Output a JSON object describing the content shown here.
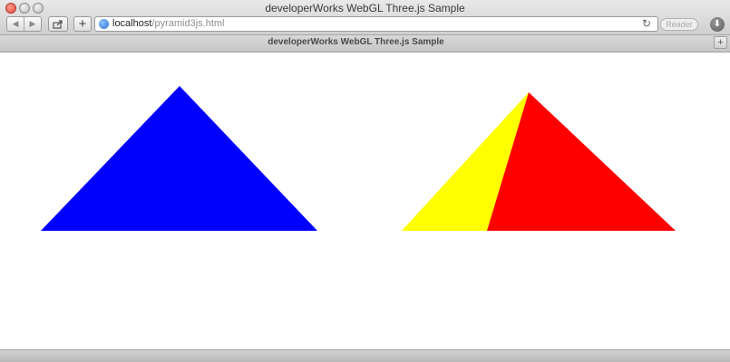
{
  "window": {
    "title": "developerWorks WebGL Three.js Sample"
  },
  "toolbar": {
    "back_glyph": "◀",
    "forward_glyph": "▶",
    "share_icon": "share-icon",
    "add_bookmark_glyph": "+",
    "address": {
      "host": "localhost",
      "path": "/pyramid3js.html"
    },
    "reload_glyph": "↻",
    "reader_label": "Reader",
    "downloads_glyph": "⬇"
  },
  "tabbar": {
    "active_tab_title": "developerWorks WebGL Three.js Sample",
    "new_tab_glyph": "+"
  },
  "scene": {
    "background": "#ffffff",
    "shapes": [
      {
        "name": "blue-triangle",
        "color": "#0000ff"
      },
      {
        "name": "yellow-pyramid-face",
        "color": "#ffff00"
      },
      {
        "name": "red-pyramid-face",
        "color": "#ff0000"
      }
    ]
  }
}
